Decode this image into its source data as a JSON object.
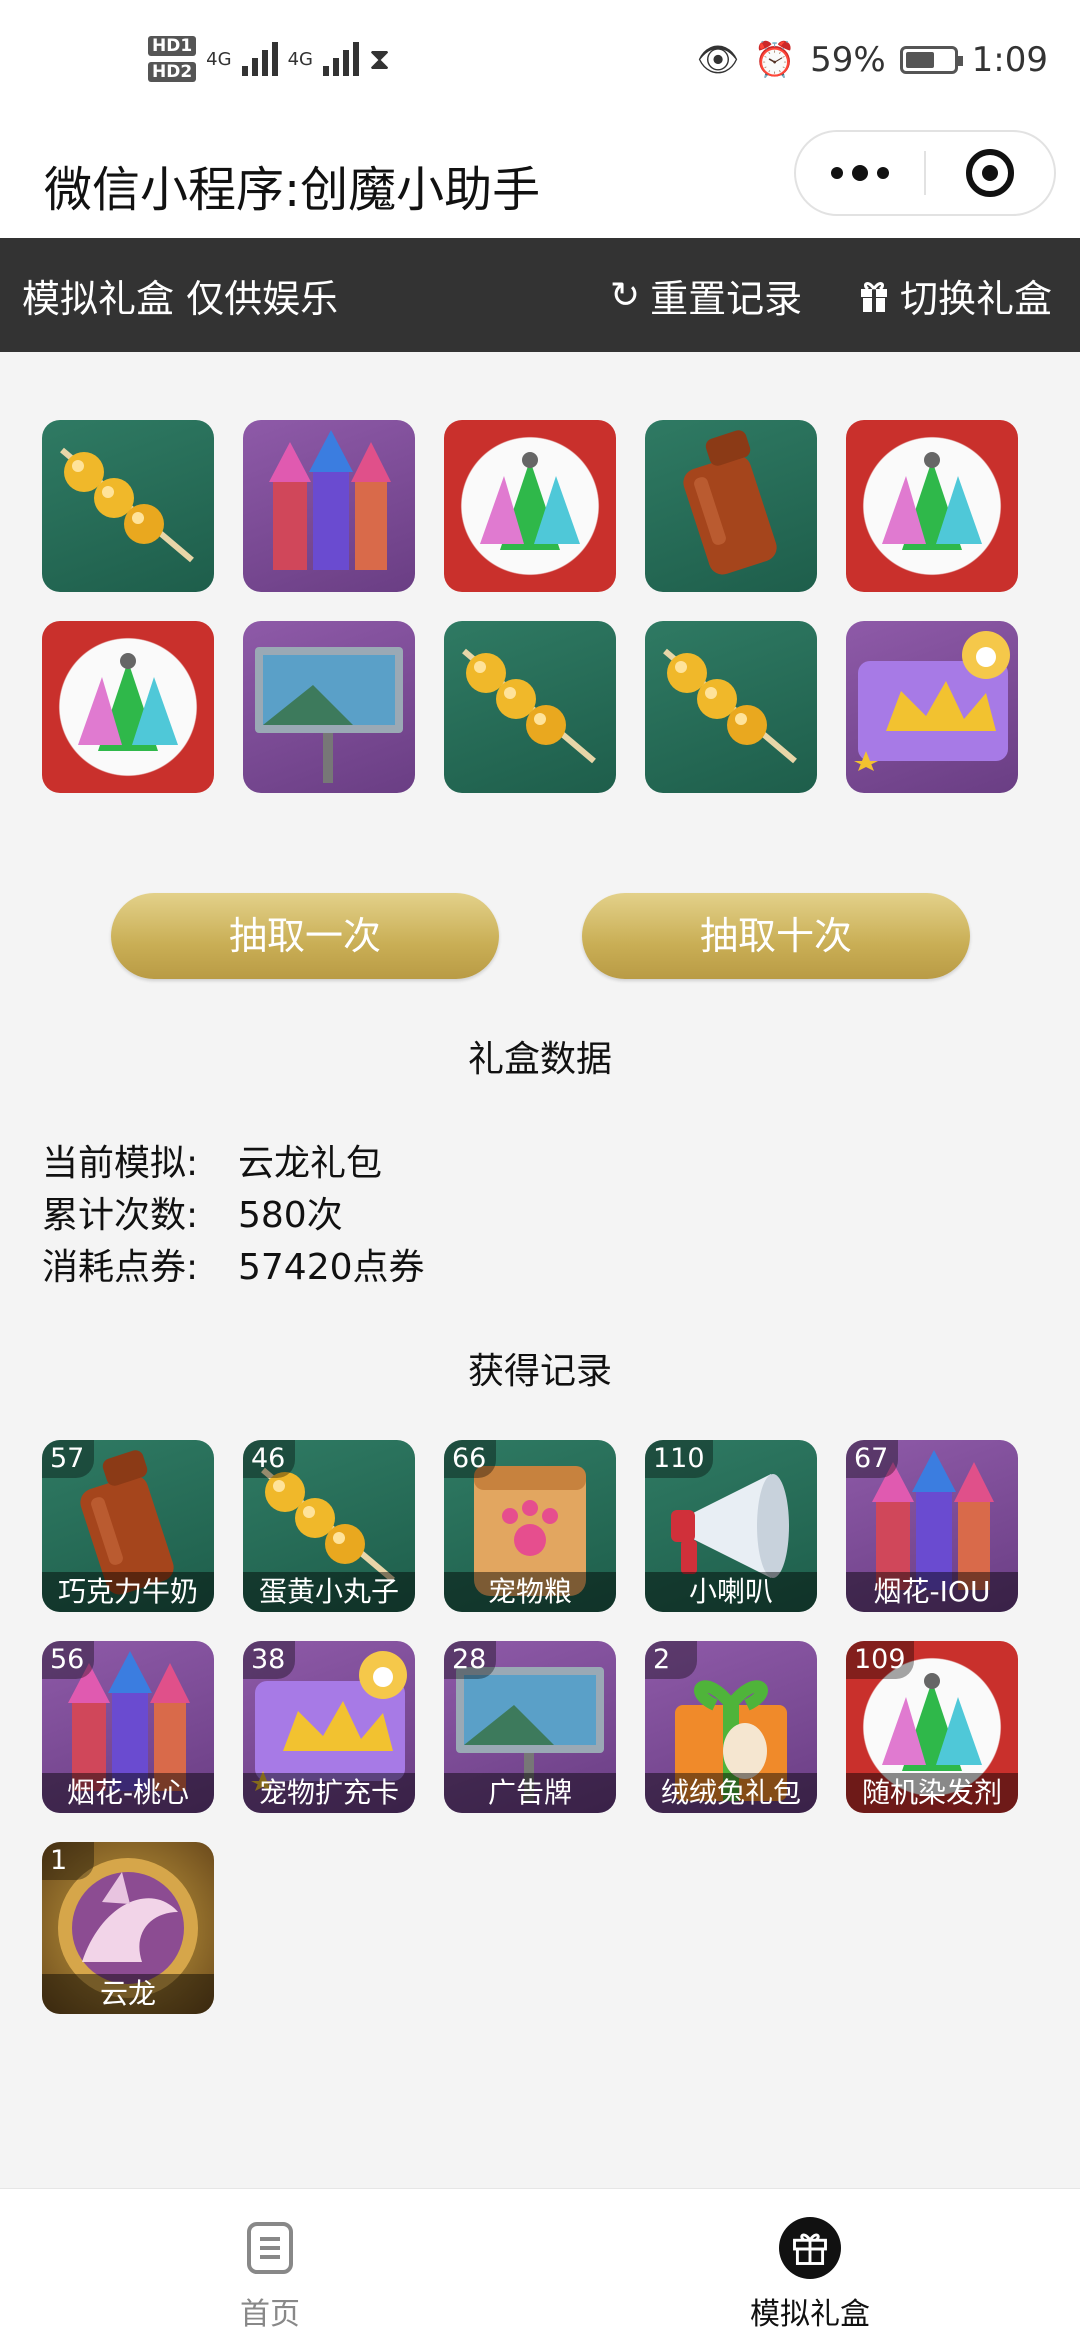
{
  "status_bar": {
    "battery": "59%",
    "time": "1:09",
    "network": "4G",
    "hd1": "HD1",
    "hd2": "HD2"
  },
  "nav": {
    "title": "微信小程序:创魔小助手"
  },
  "toolbar": {
    "title": "模拟礼盒 仅供娱乐",
    "reset_label": "重置记录",
    "switch_label": "切换礼盒"
  },
  "draw_results": [
    {
      "icon": "candied-balls-icon",
      "bg": "green"
    },
    {
      "icon": "fireworks-icon",
      "bg": "purple"
    },
    {
      "icon": "random-hair-dye-icon",
      "bg": "red"
    },
    {
      "icon": "chocolate-milk-icon",
      "bg": "green"
    },
    {
      "icon": "random-hair-dye-icon",
      "bg": "red"
    },
    {
      "icon": "random-hair-dye-icon",
      "bg": "red"
    },
    {
      "icon": "billboard-icon",
      "bg": "purple"
    },
    {
      "icon": "candied-balls-icon",
      "bg": "green"
    },
    {
      "icon": "candied-balls-icon",
      "bg": "green"
    },
    {
      "icon": "pet-expansion-card-icon",
      "bg": "purple"
    }
  ],
  "buttons": {
    "draw_once": "抽取一次",
    "draw_ten": "抽取十次"
  },
  "stats": {
    "title": "礼盒数据",
    "current_label": "当前模拟:",
    "current_value": "云龙礼包",
    "count_label": "累计次数:",
    "count_value": "580次",
    "cost_label": "消耗点券:",
    "cost_value": "57420点券"
  },
  "records_title": "获得记录",
  "records": [
    {
      "count": "57",
      "name": "巧克力牛奶",
      "icon": "chocolate-milk-icon",
      "bg": "green"
    },
    {
      "count": "46",
      "name": "蛋黄小丸子",
      "icon": "candied-balls-icon",
      "bg": "green"
    },
    {
      "count": "66",
      "name": "宠物粮",
      "icon": "pet-food-icon",
      "bg": "green"
    },
    {
      "count": "110",
      "name": "小喇叭",
      "icon": "megaphone-icon",
      "bg": "green"
    },
    {
      "count": "67",
      "name": "烟花-IOU",
      "icon": "fireworks-icon",
      "bg": "purple"
    },
    {
      "count": "56",
      "name": "烟花-桃心",
      "icon": "fireworks-icon",
      "bg": "purple"
    },
    {
      "count": "38",
      "name": "宠物扩充卡",
      "icon": "pet-expansion-card-icon",
      "bg": "purple"
    },
    {
      "count": "28",
      "name": "广告牌",
      "icon": "billboard-icon",
      "bg": "purple"
    },
    {
      "count": "2",
      "name": "绒绒兔礼包",
      "icon": "bunny-gift-icon",
      "bg": "purple"
    },
    {
      "count": "109",
      "name": "随机染发剂",
      "icon": "random-hair-dye-icon",
      "bg": "red"
    },
    {
      "count": "1",
      "name": "云龙",
      "icon": "cloud-dragon-icon",
      "bg": "gold"
    }
  ],
  "tabbar": {
    "home": "首页",
    "gift": "模拟礼盒"
  },
  "colors": {
    "dark_bar": "#333333",
    "gold_button": "#c9ae55",
    "active_tab": "#111111",
    "inactive_tab": "#888888"
  }
}
